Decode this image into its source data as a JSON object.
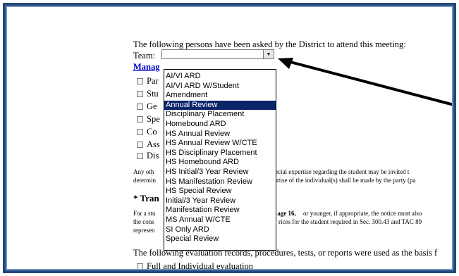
{
  "intro": "The following persons have been asked by the District to attend this meeting:",
  "team_label": "Team:",
  "team_value": "",
  "manage_link": "Manag",
  "checkboxes": [
    "Par",
    "Stu",
    "Ge",
    "Spe",
    "Co",
    "Ass",
    "Dis"
  ],
  "note_line1_right": "special expertise regarding the student may be invited t",
  "note_line1_left": "Any oth",
  "note_line2_left": "determin",
  "note_line2_right": "ertise of the individual(s) shall be made by the party (pa",
  "heading": "* Tran",
  "para_line1_left": "For a stu",
  "para_line1_mid": "t age 16,",
  "para_line1_right": " or younger, if appropriate, the notice must also",
  "para_line2_left": "the cons",
  "para_line2_right": "rices for the student required in Sec. 300.43 and TAC 89",
  "para_line3_left": "represen",
  "eval_text": "The following evaluation records, procedures, tests, or reports were used as the basis f",
  "full_eval": "Full and Individual evaluation",
  "dropdown_options": [
    "AI/VI ARD",
    "AI/VI ARD W/Student",
    "Amendment",
    "Annual Review",
    "Disciplinary Placement",
    "Homebound ARD",
    "HS Annual Review",
    "HS Annual Review W/CTE",
    "HS Disciplinary Placement",
    "HS Homebound ARD",
    "HS Initial/3 Year Review",
    "HS Manifestation Review",
    "HS Special Review",
    "Initial/3 Year Review",
    "Manifestation Review",
    "MS Annual W/CTE",
    "SI Only ARD",
    "Special Review"
  ],
  "selected_option": "Annual Review",
  "colors": {
    "frame": "#24487a",
    "highlight": "#0a246a",
    "link": "#0000cc"
  }
}
